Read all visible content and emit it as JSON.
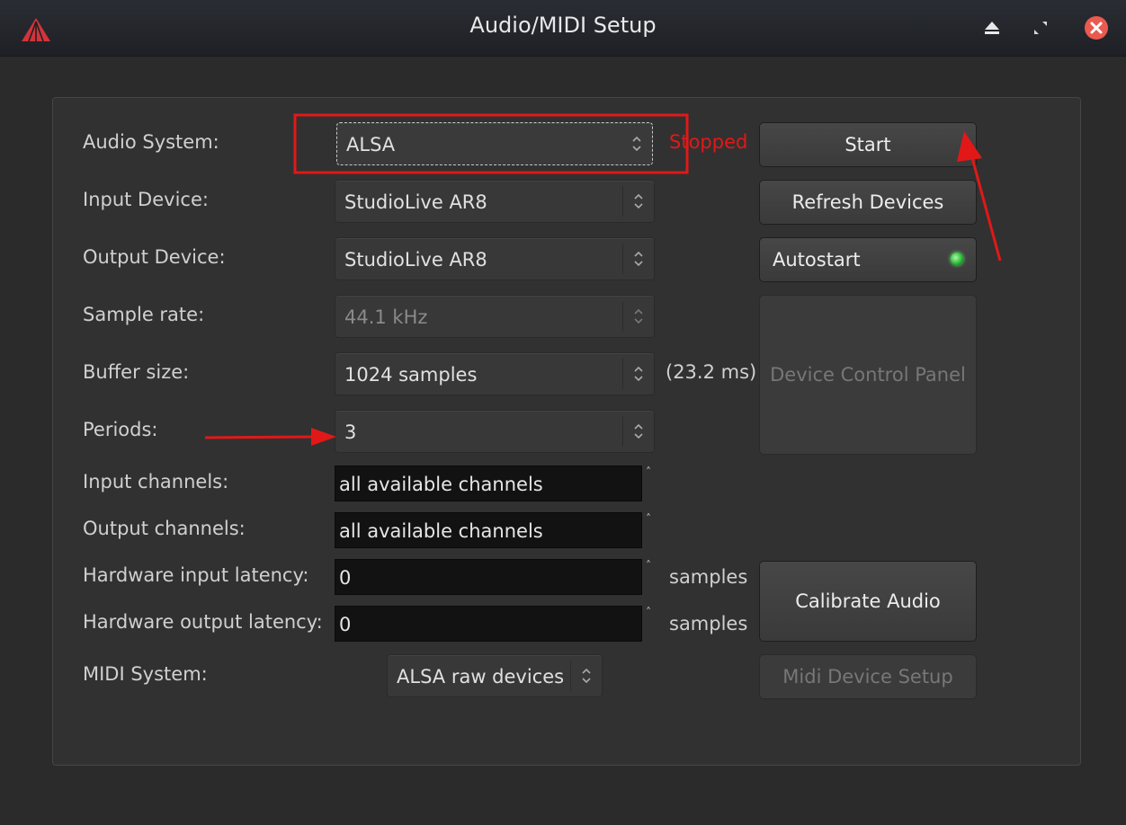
{
  "window": {
    "title": "Audio/MIDI Setup",
    "titlebar_buttons": [
      "eject-icon",
      "restore-icon",
      "close-icon"
    ]
  },
  "colors": {
    "accent_red": "#e21818",
    "led_green": "#2cbf35",
    "window_bg": "#2b2b2b",
    "panel_bg": "#313131",
    "field_bg": "#121212"
  },
  "form": {
    "audio_system": {
      "label": "Audio System:",
      "value": "ALSA"
    },
    "input_device": {
      "label": "Input Device:",
      "value": "StudioLive AR8"
    },
    "output_device": {
      "label": "Output Device:",
      "value": "StudioLive AR8"
    },
    "sample_rate": {
      "label": "Sample rate:",
      "value": "44.1 kHz"
    },
    "buffer_size": {
      "label": "Buffer size:",
      "value": "1024 samples",
      "latency": "(23.2 ms)"
    },
    "periods": {
      "label": "Periods:",
      "value": "3"
    },
    "input_channels": {
      "label": "Input channels:",
      "value": "all available channels"
    },
    "output_channels": {
      "label": "Output channels:",
      "value": "all available channels"
    },
    "hw_input_latency": {
      "label": "Hardware input latency:",
      "value": "0",
      "unit": "samples"
    },
    "hw_output_latency": {
      "label": "Hardware output latency:",
      "value": "0",
      "unit": "samples"
    },
    "midi_system": {
      "label": "MIDI System:",
      "value": "ALSA raw devices"
    }
  },
  "status": "Stopped",
  "buttons": {
    "start": "Start",
    "refresh": "Refresh Devices",
    "autostart": "Autostart",
    "device_control_panel": "Device Control Panel",
    "calibrate": "Calibrate Audio",
    "midi_device_setup": "Midi Device Setup"
  }
}
